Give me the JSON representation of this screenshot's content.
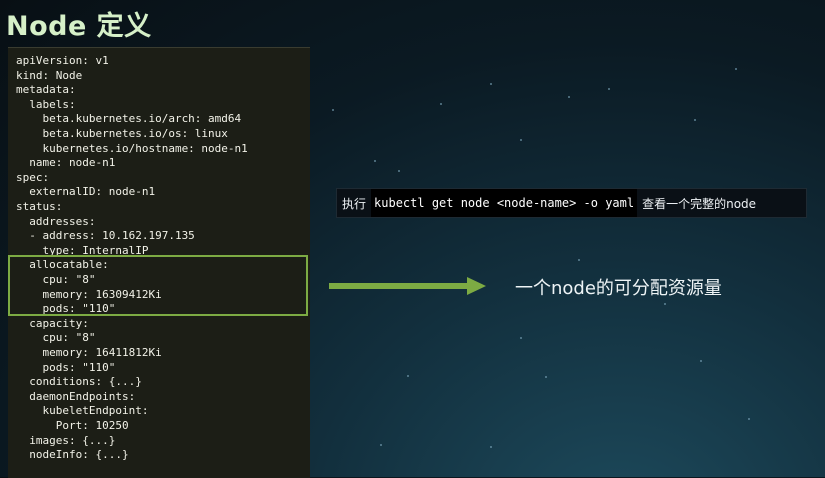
{
  "slide": {
    "title": "Node 定义",
    "callout": "一个node的可分配资源量"
  },
  "command_bar": {
    "prefix": "执行",
    "command": "kubectl get node <node-name> -o yaml",
    "suffix": "查看一个完整的node"
  },
  "yaml": {
    "lines": [
      "apiVersion: v1",
      "kind: Node",
      "metadata:",
      "  labels:",
      "    beta.kubernetes.io/arch: amd64",
      "    beta.kubernetes.io/os: linux",
      "    kubernetes.io/hostname: node-n1",
      "  name: node-n1",
      "spec:",
      "  externalID: node-n1",
      "status:",
      "  addresses:",
      "  - address: 10.162.197.135",
      "    type: InternalIP",
      "  allocatable:",
      "    cpu: \"8\"",
      "    memory: 16309412Ki",
      "    pods: \"110\"",
      "  capacity:",
      "    cpu: \"8\"",
      "    memory: 16411812Ki",
      "    pods: \"110\"",
      "  conditions: {...}",
      "  daemonEndpoints:",
      "    kubeletEndpoint:",
      "      Port: 10250",
      "  images: {...}",
      "  nodeInfo: {...}"
    ]
  },
  "colors": {
    "highlight": "#7dab43",
    "title": "#d6f0c8",
    "code_bg": "#1c1e16"
  }
}
